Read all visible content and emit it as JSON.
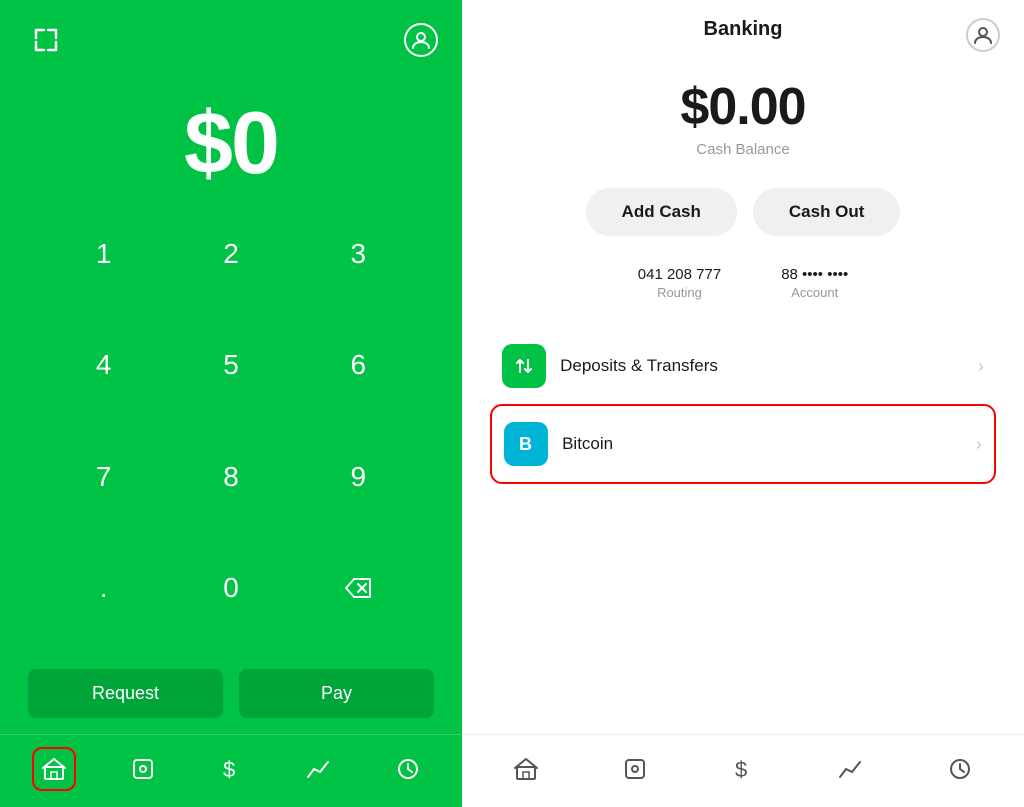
{
  "left": {
    "amount": "$0",
    "numpad": {
      "keys": [
        "1",
        "2",
        "3",
        "4",
        "5",
        "6",
        "7",
        "8",
        "9",
        ".",
        "0",
        "⌫"
      ]
    },
    "actions": {
      "request": "Request",
      "pay": "Pay"
    },
    "nav": [
      {
        "id": "home",
        "label": "Home",
        "active": true
      },
      {
        "id": "activity",
        "label": "Activity",
        "active": false
      },
      {
        "id": "cash",
        "label": "Cash",
        "active": false
      },
      {
        "id": "investing",
        "label": "Investing",
        "active": false
      },
      {
        "id": "clock",
        "label": "Clock",
        "active": false
      }
    ]
  },
  "right": {
    "header": {
      "title": "Banking"
    },
    "balance": {
      "amount": "$0.00",
      "label": "Cash Balance"
    },
    "buttons": {
      "add_cash": "Add Cash",
      "cash_out": "Cash Out"
    },
    "account": {
      "routing_value": "041 208 777",
      "routing_label": "Routing",
      "account_value": "88 •••• ••••",
      "account_label": "Account"
    },
    "menu": [
      {
        "id": "deposits",
        "label": "Deposits & Transfers",
        "icon": "transfers-icon",
        "icon_color": "green",
        "highlighted": false
      },
      {
        "id": "bitcoin",
        "label": "Bitcoin",
        "icon": "bitcoin-icon",
        "icon_color": "blue",
        "highlighted": true
      }
    ],
    "nav": [
      {
        "id": "home",
        "label": "Home"
      },
      {
        "id": "activity",
        "label": "Activity"
      },
      {
        "id": "cash",
        "label": "Cash"
      },
      {
        "id": "investing",
        "label": "Investing"
      },
      {
        "id": "clock",
        "label": "Clock"
      }
    ]
  }
}
